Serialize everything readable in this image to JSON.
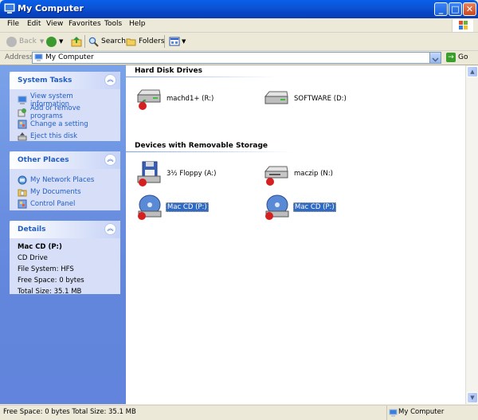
{
  "window": {
    "title": "My Computer"
  },
  "menu": [
    "File",
    "Edit",
    "View",
    "Favorites",
    "Tools",
    "Help"
  ],
  "toolbar": {
    "back": "Back",
    "search": "Search",
    "folders": "Folders"
  },
  "address": {
    "label": "Address",
    "value": "My Computer",
    "go": "Go"
  },
  "system_tasks": {
    "title": "System Tasks",
    "items": [
      "View system information",
      "Add or remove programs",
      "Change a setting",
      "Eject this disk"
    ]
  },
  "other_places": {
    "title": "Other Places",
    "items": [
      "My Network Places",
      "My Documents",
      "Control Panel"
    ]
  },
  "details": {
    "title": "Details",
    "name": "Mac CD (P:)",
    "type": "CD Drive",
    "filesystem": "File System: HFS",
    "free": "Free Space: 0 bytes",
    "total": "Total Size: 35.1 MB"
  },
  "groups": {
    "hard_disks": {
      "title": "Hard Disk Drives",
      "items": [
        {
          "label": "machd1+ (R:)",
          "icon": "hard-disk-mac-icon"
        },
        {
          "label": "SOFTWARE (D:)",
          "icon": "hard-disk-icon"
        }
      ]
    },
    "removable": {
      "title": "Devices with Removable Storage",
      "items": [
        {
          "label": "3½ Floppy (A:)",
          "icon": "floppy-drive-icon"
        },
        {
          "label": "maczip (N:)",
          "icon": "zip-drive-icon"
        },
        {
          "label": "Mac CD (P:)",
          "icon": "cd-drive-icon"
        },
        {
          "label": "Mac CD (P:)",
          "icon": "cd-drive-icon"
        }
      ]
    }
  },
  "status": {
    "left": "Free Space: 0 bytes Total Size: 35.1 MB",
    "right": "My Computer"
  },
  "colors": {
    "title_bar": "#0a54d4",
    "task_pane": "#6b8fe0",
    "selection": "#316ac5",
    "link": "#215dc6"
  }
}
